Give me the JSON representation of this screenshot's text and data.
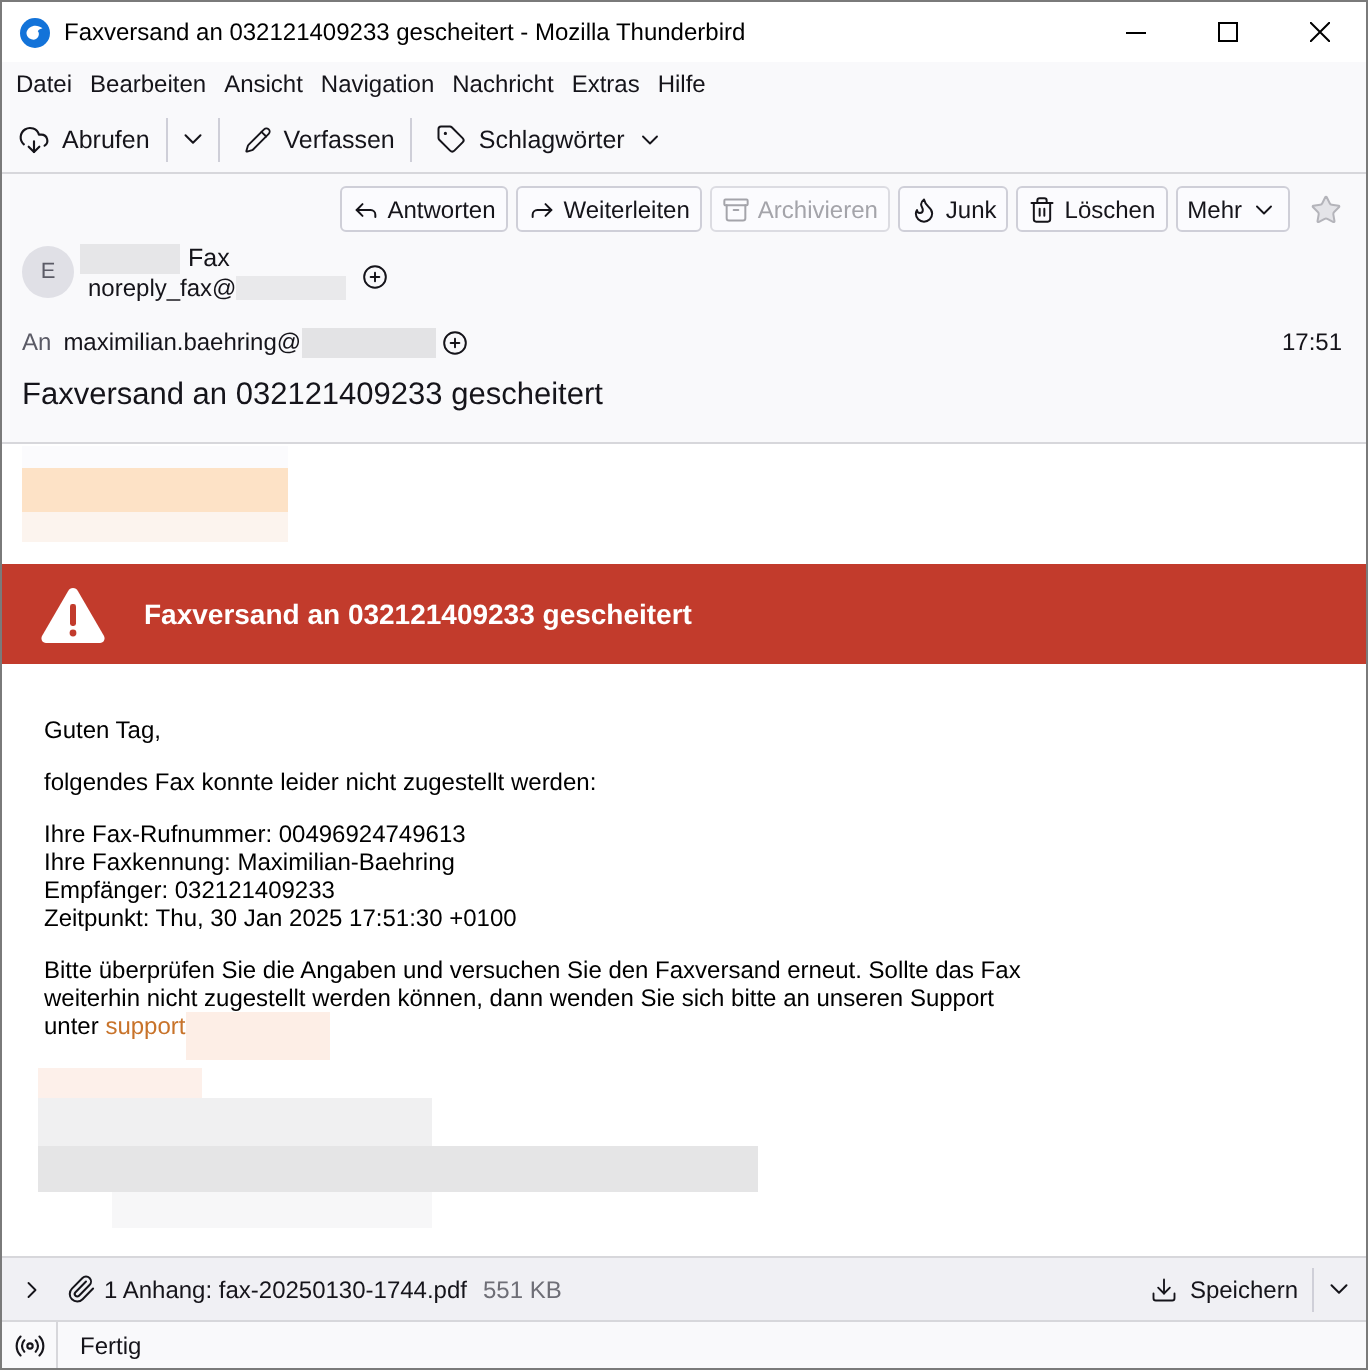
{
  "window": {
    "title": "Faxversand an 032121409233 gescheitert - Mozilla Thunderbird"
  },
  "menu_bar": [
    "Datei",
    "Bearbeiten",
    "Ansicht",
    "Navigation",
    "Nachricht",
    "Extras",
    "Hilfe"
  ],
  "toolbar": {
    "get_messages": {
      "label": "Abrufen"
    },
    "compose": {
      "label": "Verfassen"
    },
    "tags": {
      "label": "Schlagwörter"
    }
  },
  "message_header": {
    "actions": [
      {
        "kind": "button",
        "label": "Antworten",
        "disabled": false
      },
      {
        "kind": "button",
        "label": "Weiterleiten",
        "disabled": false
      },
      {
        "kind": "button",
        "label": "Archivieren",
        "disabled": true
      },
      {
        "kind": "button",
        "label": "Junk",
        "disabled": false
      },
      {
        "kind": "button",
        "label": "Löschen",
        "disabled": false
      },
      {
        "kind": "menu",
        "label": "Mehr",
        "disabled": false
      }
    ],
    "starred": false,
    "sender": {
      "avatar_letter": "E",
      "name": "Fax",
      "email": "noreply_fax@"
    },
    "recipient": {
      "label": "An",
      "email": "maximilian.baehring@"
    },
    "time": "17:51",
    "subject": "Faxversand an 032121409233 gescheitert"
  },
  "message_body": {
    "banner": {
      "title": "Faxversand an 032121409233 gescheitert"
    },
    "paragraphs": [
      {
        "kind": "lines",
        "lines": [
          "Guten Tag,"
        ]
      },
      {
        "kind": "lines",
        "lines": [
          "folgendes Fax konnte leider nicht zugestellt werden:"
        ]
      },
      {
        "kind": "lines",
        "lines": [
          "Ihre Fax-Rufnummer: 00496924749613",
          "Ihre Faxkennung: Maximilian-Baehring",
          "Empfänger: 032121409233",
          "Zeitpunkt: Thu, 30 Jan 2025 17:51:30 +0100"
        ]
      },
      {
        "kind": "link_text",
        "text": "Bitte überprüfen Sie die Angaben und versuchen Sie den Faxversand erneut. Sollte das Fax weiterhin nicht zugestellt werden können, dann wenden Sie sich bitte an unseren Support unter",
        "link": "support"
      }
    ]
  },
  "attachments": {
    "expanded": false,
    "summary": "1 Anhang: fax-20250130-1744.pdf",
    "size": "551 KB",
    "save_label": "Speichern"
  },
  "status_bar": {
    "text": "Fertig"
  }
}
